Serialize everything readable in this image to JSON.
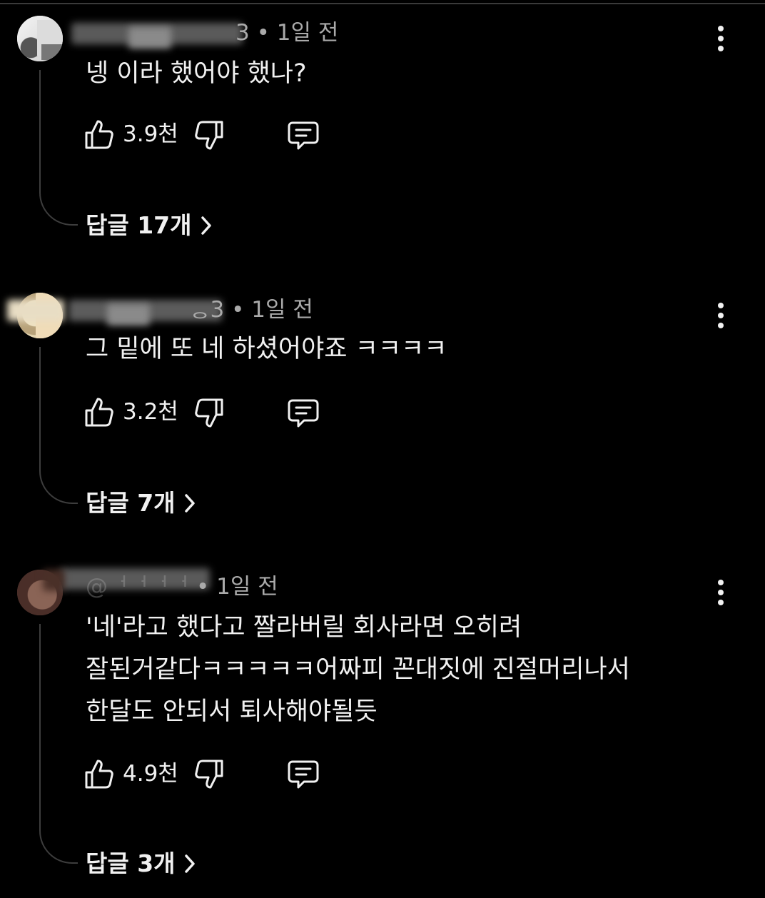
{
  "comments": [
    {
      "author_visible_fragment": "3",
      "meta_separator": "•",
      "time": "1일 전",
      "text": "넹 이라 했어야 했나?",
      "likes": "3.9천",
      "replies_label": "답글 17개",
      "more_icon": "more-vertical-icon",
      "like_icon": "thumb-up-icon",
      "dislike_icon": "thumb-down-icon",
      "reply_icon": "comment-icon",
      "chevron_icon": "chevron-right-icon"
    },
    {
      "author_visible_fragment": "ᆼ3",
      "meta_separator": "•",
      "time": "1일 전",
      "text": "그 밑에 또 네 하셨어야죠 ㅋㅋㅋㅋ",
      "likes": "3.2천",
      "replies_label": "답글 7개",
      "more_icon": "more-vertical-icon",
      "like_icon": "thumb-up-icon",
      "dislike_icon": "thumb-down-icon",
      "reply_icon": "comment-icon",
      "chevron_icon": "chevron-right-icon"
    },
    {
      "author_visible_fragment": "@ᅥᅥᅥᅥ",
      "meta_separator": "•",
      "time": "1일 전",
      "text": "'네'라고 했다고 짤라버릴 회사라면 오히려\n잘된거같다ㅋㅋㅋㅋㅋ어짜피 꼰대짓에 진절머리나서\n한달도 안되서 퇴사해야될듯",
      "likes": "4.9천",
      "replies_label": "답글 3개",
      "more_icon": "more-vertical-icon",
      "like_icon": "thumb-up-icon",
      "dislike_icon": "thumb-down-icon",
      "reply_icon": "comment-icon",
      "chevron_icon": "chevron-right-icon"
    }
  ],
  "colors": {
    "background": "#000000",
    "primary_text": "#f1f1f1",
    "secondary_text": "#aaaaaa",
    "thread_line": "#3d3d3d"
  }
}
